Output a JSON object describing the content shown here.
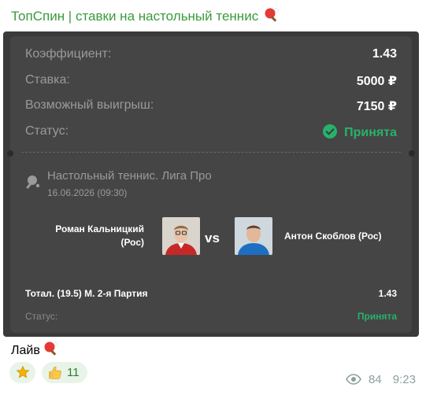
{
  "channel": {
    "title": "ТопСпин | ставки на настольный теннис",
    "title_emoji": "table-tennis-paddle-icon"
  },
  "bet_summary": {
    "rows": [
      {
        "label": "Коэффициент:",
        "value": "1.43"
      },
      {
        "label": "Ставка:",
        "value": "5000 ₽"
      },
      {
        "label": "Возможный выигрыш:",
        "value": "7150 ₽"
      },
      {
        "label": "Статус:",
        "value": "Принята"
      }
    ]
  },
  "event": {
    "league": "Настольный теннис. Лига Про",
    "datetime": "16.06.2026 (09:30)",
    "player1_line1": "Роман Кальницкий",
    "player1_line2": "(Рос)",
    "vs": "vs",
    "player2": "Антон Скоблов (Рос)",
    "bet": "Тотал. (19.5) М. 2-я Партия",
    "odds": "1.43",
    "status_label": "Статус:",
    "status_value": "Принята"
  },
  "colors": {
    "accent_green": "#27b26b",
    "channel_title": "#3a9a3c",
    "card_bg": "#3a3a3a",
    "panel_bg": "#454545"
  },
  "caption": "Лайв",
  "reactions": [
    {
      "icon": "star-icon",
      "count": ""
    },
    {
      "icon": "thumbs-up-icon",
      "count": "11"
    }
  ],
  "meta": {
    "views": "84",
    "time": "9:23"
  }
}
